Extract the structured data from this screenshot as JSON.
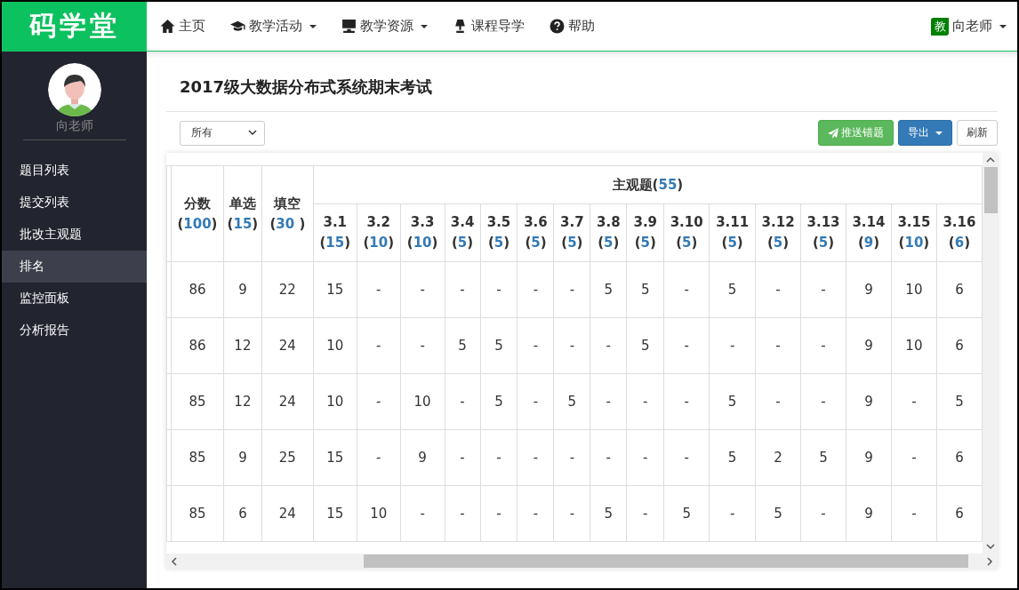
{
  "logo": "码学堂",
  "nav": [
    {
      "kind": "home",
      "label": "主页",
      "dropdown": false
    },
    {
      "kind": "cap",
      "label": "教学活动",
      "dropdown": true
    },
    {
      "kind": "monitor",
      "label": "教学资源",
      "dropdown": true
    },
    {
      "kind": "lamp",
      "label": "课程导学",
      "dropdown": false
    },
    {
      "kind": "help",
      "label": "帮助",
      "dropdown": false
    }
  ],
  "user": {
    "badge": "教",
    "name": "向老师"
  },
  "sidebar": {
    "user_name": "向老师",
    "items": [
      {
        "label": "题目列表",
        "selected": false
      },
      {
        "label": "提交列表",
        "selected": false
      },
      {
        "label": "批改主观题",
        "selected": false
      },
      {
        "label": "排名",
        "selected": true
      },
      {
        "label": "监控面板",
        "selected": false
      },
      {
        "label": "分析报告",
        "selected": false
      }
    ]
  },
  "page_title": "2017级大数据分布式系统期末考试",
  "filter": {
    "value": "所有"
  },
  "buttons": [
    {
      "kind": "push",
      "label": "推送错题"
    },
    {
      "kind": "export",
      "label": "导出"
    },
    {
      "kind": "refresh",
      "label": "刷新"
    }
  ],
  "table": {
    "group": {
      "label": "主观题",
      "open": "(",
      "points": "55",
      "close": ")"
    },
    "columns": [
      {
        "label": "分数",
        "open": "(",
        "points": "100",
        "close": ")"
      },
      {
        "label": "单选",
        "open": "(",
        "points": "15",
        "close": ")"
      },
      {
        "label": "填空",
        "open": "(",
        "points": "30",
        "close": " )"
      },
      {
        "label": "3.1",
        "open": "(",
        "points": "15",
        "close": ")"
      },
      {
        "label": "3.2",
        "open": "(",
        "points": "10",
        "close": ")"
      },
      {
        "label": "3.3",
        "open": "(",
        "points": "10",
        "close": ")"
      },
      {
        "label": "3.4",
        "open": "(",
        "points": "5",
        "close": ")"
      },
      {
        "label": "3.5",
        "open": "(",
        "points": "5",
        "close": ")"
      },
      {
        "label": "3.6",
        "open": "(",
        "points": "5",
        "close": ")"
      },
      {
        "label": "3.7",
        "open": "(",
        "points": "5",
        "close": ")"
      },
      {
        "label": "3.8",
        "open": "(",
        "points": "5",
        "close": ")"
      },
      {
        "label": "3.9",
        "open": "(",
        "points": "5",
        "close": ")"
      },
      {
        "label": "3.10",
        "open": "(",
        "points": "5",
        "close": ")"
      },
      {
        "label": "3.11",
        "open": "(",
        "points": "5",
        "close": ")"
      },
      {
        "label": "3.12",
        "open": "(",
        "points": "5",
        "close": ")"
      },
      {
        "label": "3.13",
        "open": "(",
        "points": "5",
        "close": ")"
      },
      {
        "label": "3.14",
        "open": "(",
        "points": "9",
        "close": ")"
      },
      {
        "label": "3.15",
        "open": "(",
        "points": "10",
        "close": ")"
      },
      {
        "label": "3.16",
        "open": "(",
        "points": "6",
        "close": ")"
      }
    ],
    "rows": [
      [
        "86",
        "9",
        "22",
        "15",
        "-",
        "-",
        "-",
        "-",
        "-",
        "-",
        "5",
        "5",
        "-",
        "5",
        "-",
        "-",
        "9",
        "10",
        "6"
      ],
      [
        "86",
        "12",
        "24",
        "10",
        "-",
        "-",
        "5",
        "5",
        "-",
        "-",
        "-",
        "5",
        "-",
        "-",
        "-",
        "-",
        "9",
        "10",
        "6"
      ],
      [
        "85",
        "12",
        "24",
        "10",
        "-",
        "10",
        "-",
        "5",
        "-",
        "5",
        "-",
        "-",
        "-",
        "5",
        "-",
        "-",
        "9",
        "-",
        "5"
      ],
      [
        "85",
        "9",
        "25",
        "15",
        "-",
        "9",
        "-",
        "-",
        "-",
        "-",
        "-",
        "-",
        "-",
        "5",
        "2",
        "5",
        "9",
        "-",
        "6"
      ],
      [
        "85",
        "6",
        "24",
        "15",
        "10",
        "-",
        "-",
        "-",
        "-",
        "-",
        "5",
        "-",
        "5",
        "-",
        "5",
        "-",
        "9",
        "-",
        "6"
      ]
    ]
  }
}
